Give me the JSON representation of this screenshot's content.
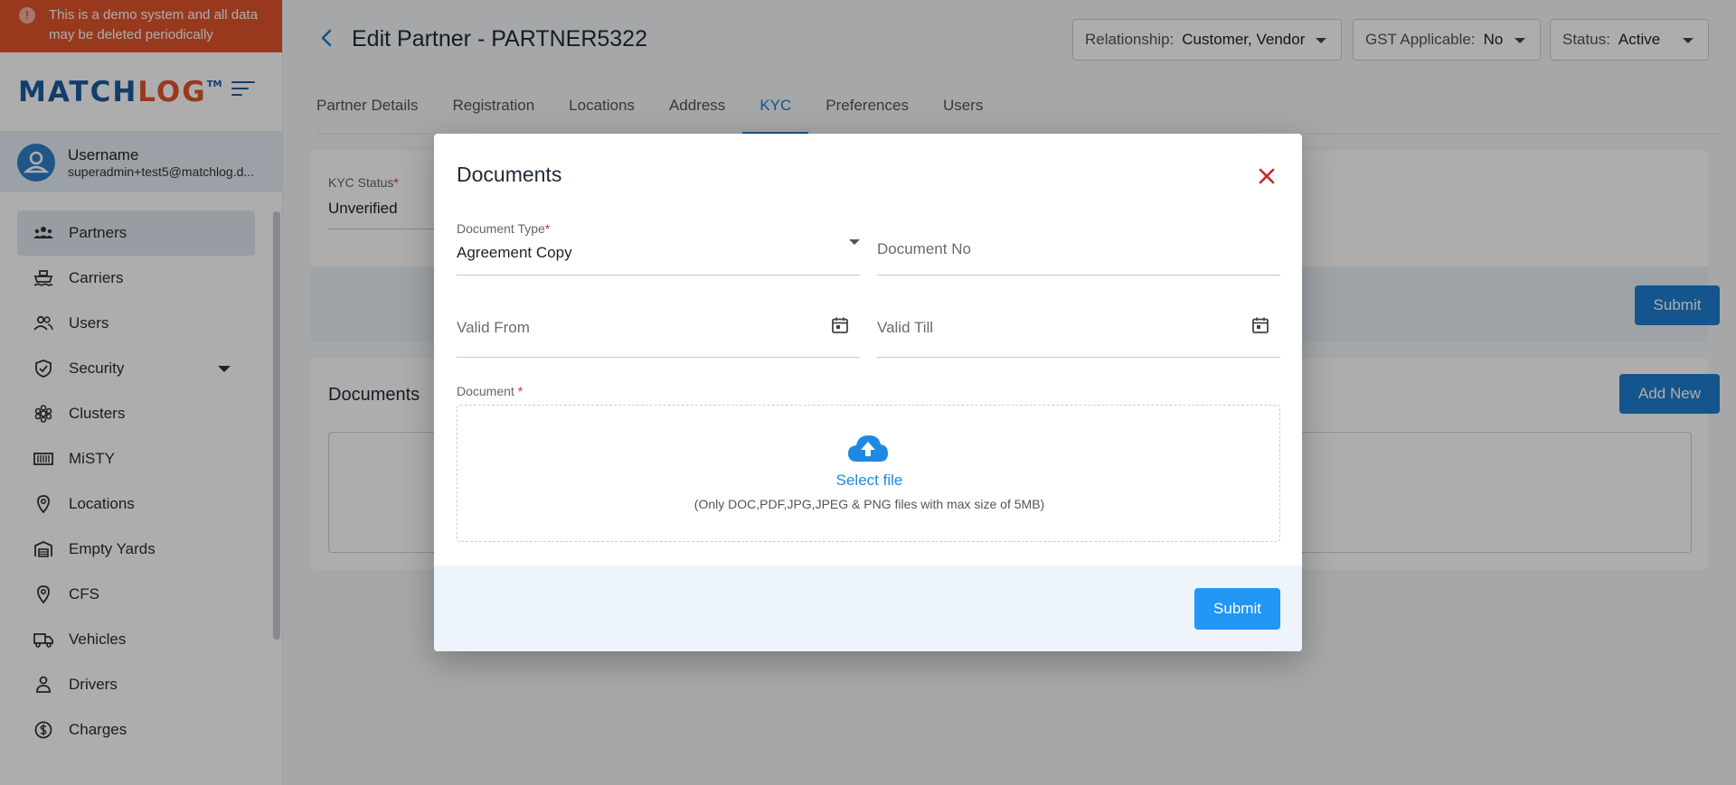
{
  "banner": {
    "text": "This is a demo system and all data may be deleted periodically"
  },
  "logo": {
    "part1": "MATCH",
    "part2": "LOG",
    "tm": "TM"
  },
  "user": {
    "name": "Username",
    "email": "superadmin+test5@matchlog.d..."
  },
  "nav": [
    {
      "label": "Partners",
      "icon": "partners-icon"
    },
    {
      "label": "Carriers",
      "icon": "ship-icon"
    },
    {
      "label": "Users",
      "icon": "users-icon"
    },
    {
      "label": "Security",
      "icon": "shield-icon"
    },
    {
      "label": "Clusters",
      "icon": "cluster-icon"
    },
    {
      "label": "MiSTY",
      "icon": "container-icon"
    },
    {
      "label": "Locations",
      "icon": "location-pin-icon"
    },
    {
      "label": "Empty Yards",
      "icon": "warehouse-icon"
    },
    {
      "label": "CFS",
      "icon": "location-pin-icon"
    },
    {
      "label": "Vehicles",
      "icon": "truck-icon"
    },
    {
      "label": "Drivers",
      "icon": "person-icon"
    },
    {
      "label": "Charges",
      "icon": "dollar-icon"
    }
  ],
  "header": {
    "title": "Edit Partner - PARTNER5322",
    "relationship": {
      "label": "Relationship:",
      "value": "Customer, Vendor"
    },
    "gst": {
      "label": "GST Applicable:",
      "value": "No"
    },
    "status": {
      "label": "Status:",
      "value": "Active"
    }
  },
  "tabs": [
    "Partner Details",
    "Registration",
    "Locations",
    "Address",
    "KYC",
    "Preferences",
    "Users"
  ],
  "active_tab": "KYC",
  "kyc": {
    "status_label": "KYC Status",
    "required": "*",
    "status_value": "Unverified",
    "submit_label": "Submit"
  },
  "documents_card": {
    "title": "Documents",
    "add_new_label": "Add New"
  },
  "modal": {
    "title": "Documents",
    "document_type": {
      "label": "Document Type",
      "required": "*",
      "value": "Agreement Copy"
    },
    "document_no": {
      "placeholder": "Document No"
    },
    "valid_from": {
      "placeholder": "Valid From"
    },
    "valid_till": {
      "placeholder": "Valid Till"
    },
    "document": {
      "label": "Document",
      "required": "*"
    },
    "upload": {
      "link": "Select file",
      "hint": "(Only DOC,PDF,JPG,JPEG & PNG files with max size of 5MB)"
    },
    "submit_label": "Submit"
  },
  "colors": {
    "accent": "#1f7ed0",
    "brand_blue": "#1b5b9f",
    "brand_orange": "#e0552b",
    "required": "#d32f2f"
  }
}
